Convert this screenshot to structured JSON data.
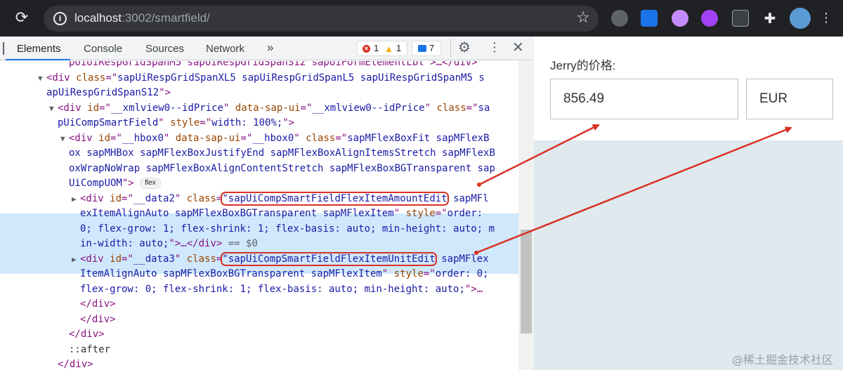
{
  "browser": {
    "url_host": "localhost",
    "url_rest": ":3002/smartfield/"
  },
  "devtools": {
    "tabs": [
      "Elements",
      "Console",
      "Sources",
      "Network"
    ],
    "more_tabs": "»",
    "errors": "1",
    "warnings": "1",
    "messages": "7",
    "code_lines": [
      {
        "i": 5,
        "parts": [
          [
            "tag",
            "poiUiRespGridSpanM5 sapUiRespGridSpanS12 sapUiFormElementLbl\">…</div>"
          ]
        ]
      },
      {
        "i": 3,
        "tri": "▼",
        "parts": [
          [
            "tag",
            "<div "
          ],
          [
            "attr",
            "class"
          ],
          [
            "tag",
            "=\""
          ],
          [
            "val",
            "sapUiRespGridSpanXL5 sapUiRespGridSpanL5 sapUiRespGridSpanM5 s"
          ]
        ]
      },
      {
        "i": 3,
        "parts": [
          [
            "val",
            "apUiRespGridSpanS12"
          ],
          [
            "tag",
            "\">"
          ]
        ]
      },
      {
        "i": 4,
        "tri": "▼",
        "parts": [
          [
            "tag",
            "<div "
          ],
          [
            "attr",
            "id"
          ],
          [
            "tag",
            "=\""
          ],
          [
            "val",
            "__xmlview0--idPrice"
          ],
          [
            "tag",
            "\" "
          ],
          [
            "attr",
            "data-sap-ui"
          ],
          [
            "tag",
            "=\""
          ],
          [
            "val",
            "__xmlview0--idPrice"
          ],
          [
            "tag",
            "\" "
          ],
          [
            "attr",
            "class"
          ],
          [
            "tag",
            "=\""
          ],
          [
            "val",
            "sa"
          ]
        ]
      },
      {
        "i": 4,
        "parts": [
          [
            "val",
            "pUiCompSmartField"
          ],
          [
            "tag",
            "\" "
          ],
          [
            "attr",
            "style"
          ],
          [
            "tag",
            "=\""
          ],
          [
            "val",
            "width: 100%;"
          ],
          [
            "tag",
            "\">"
          ]
        ]
      },
      {
        "i": 5,
        "tri": "▼",
        "parts": [
          [
            "tag",
            "<div "
          ],
          [
            "attr",
            "id"
          ],
          [
            "tag",
            "=\""
          ],
          [
            "val",
            "__hbox0"
          ],
          [
            "tag",
            "\" "
          ],
          [
            "attr",
            "data-sap-ui"
          ],
          [
            "tag",
            "=\""
          ],
          [
            "val",
            "__hbox0"
          ],
          [
            "tag",
            "\" "
          ],
          [
            "attr",
            "class"
          ],
          [
            "tag",
            "=\""
          ],
          [
            "val",
            "sapMFlexBoxFit sapMFlexB"
          ]
        ]
      },
      {
        "i": 5,
        "parts": [
          [
            "val",
            "ox sapMHBox sapMFlexBoxJustifyEnd sapMFlexBoxAlignItemsStretch sapMFlexB"
          ]
        ]
      },
      {
        "i": 5,
        "parts": [
          [
            "val",
            "oxWrapNoWrap sapMFlexBoxAlignContentStretch sapMFlexBoxBGTransparent sap"
          ]
        ]
      },
      {
        "i": 5,
        "parts": [
          [
            "val",
            "UiCompUOM"
          ],
          [
            "tag",
            "\">"
          ]
        ],
        "pill": "flex"
      },
      {
        "i": 6,
        "tri": "▶",
        "parts": [
          [
            "tag",
            "<div "
          ],
          [
            "attr",
            "id"
          ],
          [
            "tag",
            "=\""
          ],
          [
            "val",
            "__data2"
          ],
          [
            "tag",
            "\" "
          ],
          [
            "attr",
            "class"
          ],
          [
            "tag",
            "="
          ],
          [
            "boxval",
            "\"sapUiCompSmartFieldFlexItemAmountEdit"
          ],
          [
            "val",
            " sapMFl"
          ]
        ]
      },
      {
        "i": 6,
        "parts": [
          [
            "val",
            "exItemAlignAuto sapMFlexBoxBGTransparent sapMFlexItem"
          ],
          [
            "tag",
            "\" "
          ],
          [
            "attr",
            "style"
          ],
          [
            "tag",
            "=\""
          ],
          [
            "val",
            "order:"
          ]
        ]
      },
      {
        "i": 6,
        "parts": [
          [
            "val",
            "0; flex-grow: 1; flex-shrink: 1; flex-basis: auto; min-height: auto; m"
          ]
        ]
      },
      {
        "i": 6,
        "parts": [
          [
            "val",
            "in-width: auto;"
          ],
          [
            "tag",
            "\">…</div>"
          ],
          [
            "gray",
            " == $0"
          ]
        ]
      },
      {
        "i": 6,
        "tri": "▶",
        "parts": [
          [
            "tag",
            "<div "
          ],
          [
            "attr",
            "id"
          ],
          [
            "tag",
            "=\""
          ],
          [
            "val",
            "__data3"
          ],
          [
            "tag",
            "\" "
          ],
          [
            "attr",
            "class"
          ],
          [
            "tag",
            "="
          ],
          [
            "boxval",
            "\"sapUiCompSmartFieldFlexItemUnitEdit"
          ],
          [
            "val",
            " sapMFlex"
          ]
        ]
      },
      {
        "i": 6,
        "parts": [
          [
            "val",
            "ItemAlignAuto sapMFlexBoxBGTransparent sapMFlexItem"
          ],
          [
            "tag",
            "\" "
          ],
          [
            "attr",
            "style"
          ],
          [
            "tag",
            "=\""
          ],
          [
            "val",
            "order: 0;"
          ]
        ]
      },
      {
        "i": 6,
        "parts": [
          [
            "val",
            "flex-grow: 0; flex-shrink: 1; flex-basis: auto; min-height: auto;"
          ],
          [
            "tag",
            "\">…"
          ]
        ]
      },
      {
        "i": 6,
        "parts": [
          [
            "tag",
            "</div>"
          ]
        ]
      },
      {
        "i": 6,
        "parts": [
          [
            "tag",
            "</div>"
          ]
        ]
      },
      {
        "i": 5,
        "parts": [
          [
            "tag",
            "</div>"
          ]
        ]
      },
      {
        "i": 5,
        "parts": [
          [
            "txt",
            "::after"
          ]
        ]
      },
      {
        "i": 4,
        "parts": [
          [
            "tag",
            "</div>"
          ]
        ]
      }
    ]
  },
  "app": {
    "price_label": "Jerry的价格:",
    "amount_value": "856.49",
    "unit_value": "EUR"
  },
  "watermark": "@稀土掘金技术社区",
  "colors": {
    "chrome_bg": "#202124",
    "highlight": "#cfe8fc",
    "annotation_red": "#d93025"
  }
}
